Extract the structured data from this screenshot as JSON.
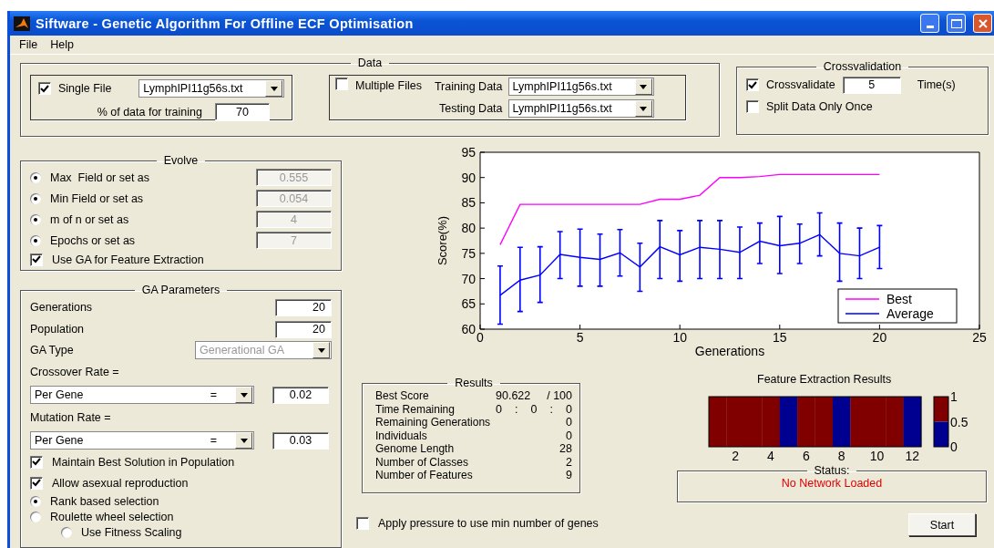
{
  "window": {
    "title": "Siftware - Genetic Algorithm For Offline ECF Optimisation"
  },
  "menu": [
    "File",
    "Help"
  ],
  "data_panel": {
    "title": "Data",
    "single_file": {
      "label": "Single File",
      "checked": true,
      "file": "LymphIPI11g56s.txt",
      "training_label": "% of data for training",
      "training_value": "70"
    },
    "multiple_files": {
      "label": "Multiple Files",
      "checked": false,
      "training_label": "Training Data",
      "training_file": "LymphIPI11g56s.txt",
      "testing_label": "Testing Data",
      "testing_file": "LymphIPI11g56s.txt"
    }
  },
  "crossvalidation": {
    "title": "Crossvalidation",
    "crossvalidate": {
      "label": "Crossvalidate",
      "checked": true,
      "value": "5",
      "unit": "Time(s)"
    },
    "split_once": {
      "label": "Split Data Only Once",
      "checked": false
    }
  },
  "evolve": {
    "title": "Evolve",
    "options": [
      {
        "label": "Max  Field or set as",
        "selected": true,
        "value": "0.555",
        "disabled": true
      },
      {
        "label": "Min Field or set as",
        "selected": true,
        "value": "0.054",
        "disabled": true
      },
      {
        "label": "m of n or set as",
        "selected": true,
        "value": "4",
        "disabled": true
      },
      {
        "label": "Epochs or set as",
        "selected": true,
        "value": "7",
        "disabled": true
      }
    ],
    "use_ga": {
      "label": "Use GA for Feature Extraction",
      "checked": true
    }
  },
  "ga_parameters": {
    "title": "GA Parameters",
    "fields": [
      {
        "label": "Generations",
        "value": "20"
      },
      {
        "label": "Population",
        "value": "20"
      }
    ],
    "ga_type": {
      "label": "GA Type",
      "value": "Generational GA",
      "disabled": true
    },
    "rates": [
      {
        "label": "Crossover Rate =",
        "mode": "Per Gene",
        "operator": "=",
        "value": "0.02"
      },
      {
        "label": "Mutation Rate =",
        "mode": "Per Gene",
        "operator": "=",
        "value": "0.03"
      }
    ],
    "options": [
      {
        "kind": "checkbox",
        "label": "Maintain Best Solution in Population",
        "checked": true
      },
      {
        "kind": "checkbox",
        "label": "Allow asexual reproduction",
        "checked": true
      },
      {
        "kind": "radio",
        "label": "Rank based selection",
        "selected": true
      },
      {
        "kind": "radio",
        "label": "Roulette wheel selection",
        "selected": false
      },
      {
        "kind": "sub_radio",
        "label": "Use Fitness Scaling",
        "selected": false
      }
    ]
  },
  "score_chart": {
    "chart_data": {
      "type": "line",
      "xlabel": "Generations",
      "ylabel": "Score(%)",
      "x": [
        1,
        2,
        3,
        4,
        5,
        6,
        7,
        8,
        9,
        10,
        11,
        12,
        13,
        14,
        15,
        16,
        17,
        18,
        19,
        20
      ],
      "xlim": [
        0,
        25
      ],
      "ylim": [
        60,
        95
      ],
      "xticks": [
        0,
        5,
        10,
        15,
        20,
        25
      ],
      "yticks": [
        60,
        65,
        70,
        75,
        80,
        85,
        90,
        95
      ],
      "series": [
        {
          "name": "Best",
          "color": "#ff00ff",
          "values": [
            76.7,
            84.7,
            84.7,
            84.7,
            84.7,
            84.7,
            84.7,
            84.7,
            85.7,
            85.7,
            86.5,
            90,
            90,
            90.2,
            90.6,
            90.6,
            90.6,
            90.6,
            90.6,
            90.6
          ]
        },
        {
          "name": "Average",
          "color": "#0000ff",
          "values": [
            66.7,
            69.7,
            70.7,
            74.8,
            74.2,
            73.8,
            75.1,
            72.3,
            76.3,
            74.7,
            76.2,
            75.8,
            75.2,
            77.4,
            76.5,
            77,
            78.7,
            75,
            74.5,
            76.2
          ],
          "errors": [
            [
              61,
              72.5
            ],
            [
              63.5,
              76.2
            ],
            [
              65.3,
              76.3
            ],
            [
              70,
              79.3
            ],
            [
              68.5,
              79.8
            ],
            [
              68.5,
              78.8
            ],
            [
              70.5,
              79.7
            ],
            [
              67.5,
              77
            ],
            [
              70,
              81.5
            ],
            [
              69.5,
              79.5
            ],
            [
              70,
              81.5
            ],
            [
              70,
              81.5
            ],
            [
              70,
              80.2
            ],
            [
              73,
              81
            ],
            [
              71,
              82.3
            ],
            [
              73,
              80.8
            ],
            [
              74.5,
              83
            ],
            [
              69.5,
              81
            ],
            [
              70,
              80
            ],
            [
              72,
              80.5
            ]
          ]
        }
      ],
      "legend": "lower right"
    }
  },
  "results": {
    "title": "Results",
    "rows": [
      {
        "label": "Best Score",
        "values": [
          "90.622",
          "/ 100"
        ]
      },
      {
        "label": "Time Remaining",
        "values": [
          "0",
          ":",
          "0",
          ":",
          "0"
        ]
      },
      {
        "label": "Remaining Generations",
        "values": [
          "0"
        ]
      },
      {
        "label": "Individuals",
        "values": [
          "0"
        ]
      },
      {
        "label": "Genome Length",
        "values": [
          "28"
        ]
      },
      {
        "label": "Number of Classes",
        "values": [
          "2"
        ]
      },
      {
        "label": "Number of Features",
        "values": [
          "9"
        ]
      }
    ]
  },
  "pressure": {
    "label": "Apply pressure to use min number of genes",
    "checked": false
  },
  "feature_extraction": {
    "title": "Feature Extraction Results",
    "genes": [
      {
        "on": true
      },
      {
        "on": true
      },
      {
        "on": true
      },
      {
        "on": true
      },
      {
        "on": false
      },
      {
        "on": true
      },
      {
        "on": true
      },
      {
        "on": false
      },
      {
        "on": true
      },
      {
        "on": true
      },
      {
        "on": true
      },
      {
        "on": false
      }
    ],
    "x_labels": [
      "2",
      "4",
      "6",
      "8",
      "10",
      "12"
    ],
    "scale_labels": [
      "1",
      "0.5",
      "0"
    ]
  },
  "status": {
    "title": "Status:",
    "message": "No Network Loaded"
  },
  "start_button": "Start"
}
